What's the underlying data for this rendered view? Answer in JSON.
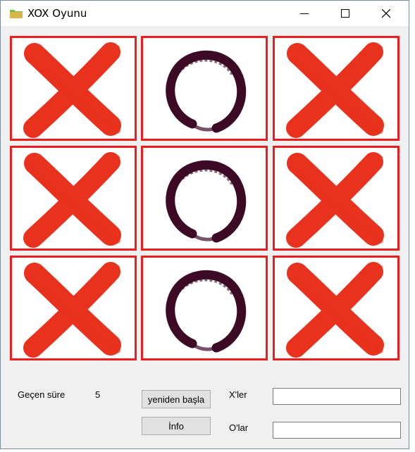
{
  "window": {
    "title": "XOX Oyunu",
    "app_icon": "folder-icon",
    "controls": [
      "minimize-icon",
      "maximize-icon",
      "close-icon"
    ]
  },
  "board": {
    "cells": [
      "X",
      "O",
      "X",
      "X",
      "O",
      "X",
      "X",
      "O",
      "X"
    ],
    "cell_border_color": "#ee1c1c",
    "x_color": "#e8321e",
    "o_color": "#3d0a26"
  },
  "timer": {
    "label": "Geçen süre",
    "value": "5"
  },
  "buttons": {
    "restart": "yeniden başla",
    "info": "İnfo"
  },
  "scores": {
    "x_label": "X'ler",
    "x_value": "",
    "o_label": "O'lar",
    "o_value": ""
  }
}
